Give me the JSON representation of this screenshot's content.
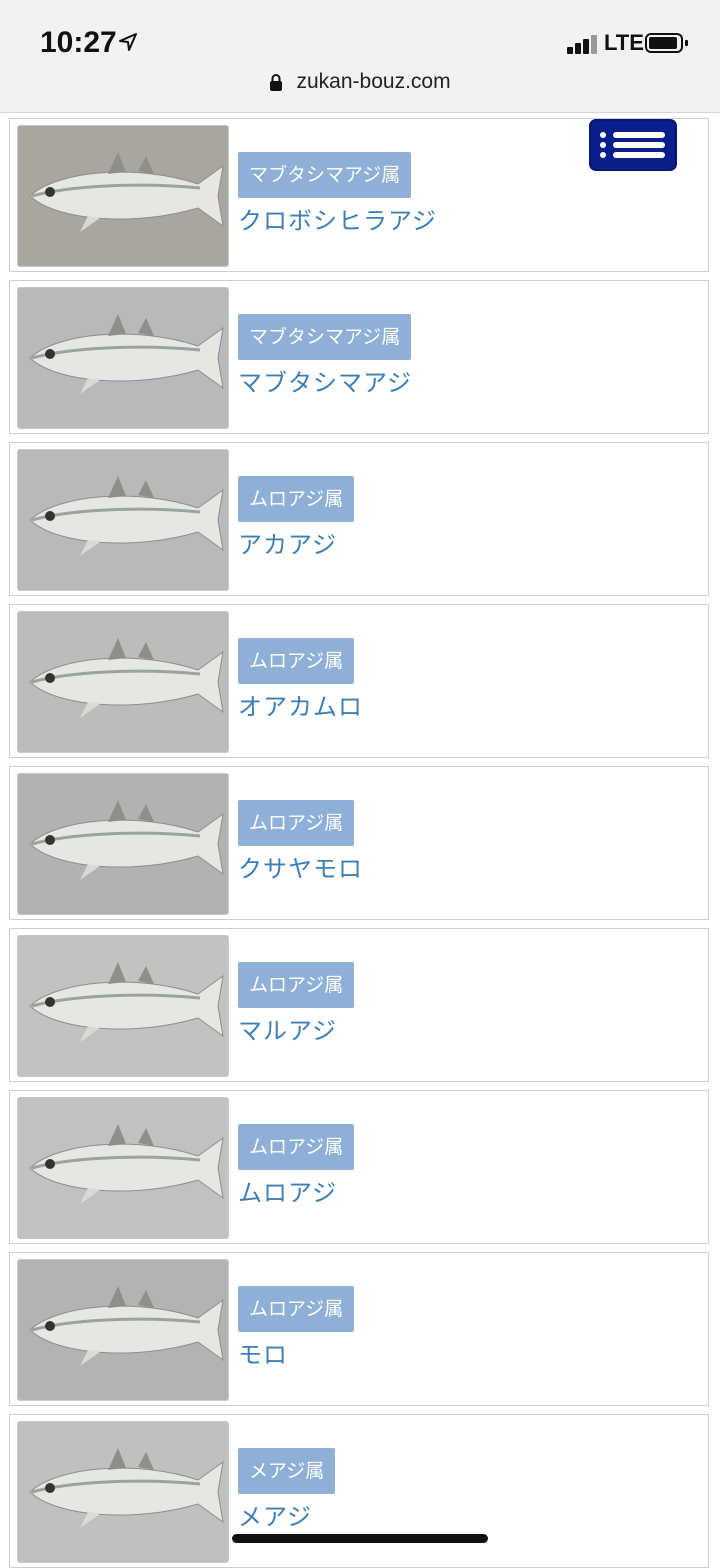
{
  "status_bar": {
    "time": "10:27",
    "network": "LTE",
    "location_icon": "location-arrow-icon",
    "signal_icon": "cellular-signal-icon",
    "battery_icon": "battery-icon"
  },
  "browser": {
    "url": "zukan-bouz.com",
    "lock_icon": "lock-icon"
  },
  "menu_button": {
    "icon": "hamburger-list-icon",
    "color": "#0b1f8c"
  },
  "colors": {
    "genus_badge": "#8fb0d6",
    "species_link": "#3d7fb4"
  },
  "fish_list": [
    {
      "genus": "マブタシマアジ属",
      "name": "クロボシヒラアジ"
    },
    {
      "genus": "マブタシマアジ属",
      "name": "マブタシマアジ"
    },
    {
      "genus": "ムロアジ属",
      "name": "アカアジ"
    },
    {
      "genus": "ムロアジ属",
      "name": "オアカムロ"
    },
    {
      "genus": "ムロアジ属",
      "name": "クサヤモロ"
    },
    {
      "genus": "ムロアジ属",
      "name": "マルアジ"
    },
    {
      "genus": "ムロアジ属",
      "name": "ムロアジ"
    },
    {
      "genus": "ムロアジ属",
      "name": "モロ"
    },
    {
      "genus": "メアジ属",
      "name": "メアジ"
    }
  ]
}
